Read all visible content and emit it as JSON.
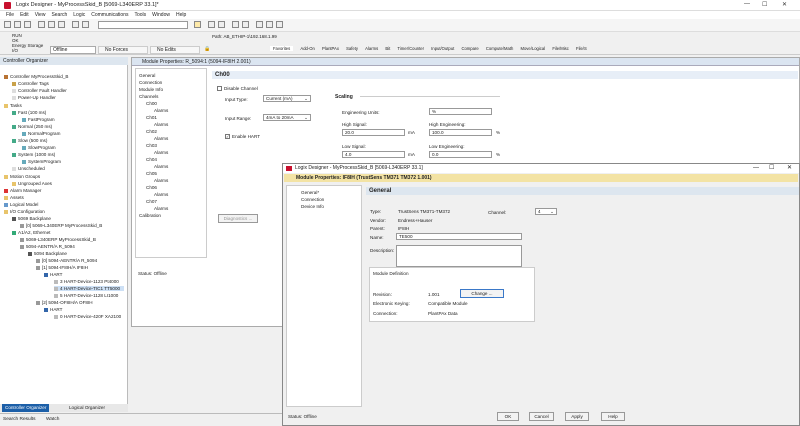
{
  "app": {
    "title": "Logix Designer - MyProcessSkid_B [5069-L340ERP 33.1]*",
    "menu": [
      "File",
      "Edit",
      "View",
      "Search",
      "Logic",
      "Communications",
      "Tools",
      "Window",
      "Help"
    ]
  },
  "status": {
    "run": "RUN",
    "ok": "OK",
    "energy": "Energy Storage",
    "io": "I/O",
    "offline": "Offline",
    "forces": "No Forces",
    "edits": "No Edits",
    "path": "Path: AB_ETHIP-1\\192.168.1.99"
  },
  "toolbar_tabs": [
    "Favorites",
    "Add-On",
    "PlantPAx",
    "Safety",
    "Alarms",
    "Bit",
    "Timer/Counter",
    "Input/Output",
    "Compare",
    "Compute/Math",
    "Move/Logical",
    "File/Misc",
    "File/S"
  ],
  "organizer": {
    "title": "Controller Organizer",
    "items": [
      "Controller MyProcessSkid_B",
      "Controller Tags",
      "Controller Fault Handler",
      "Power-Up Handler",
      "Tasks",
      "Fast (100 ms)",
      "FastProgram",
      "Normal (250 ms)",
      "NormalProgram",
      "Slow (500 ms)",
      "SlowProgram",
      "System (1000 ms)",
      "SystemProgram",
      "Unscheduled",
      "Motion Groups",
      "Ungrouped Axes",
      "Alarm Manager",
      "Assets",
      "Logical Model",
      "I/O Configuration",
      "5069 Backplane",
      "[0] 5069-L340ERP MyProcessSkid_B",
      "A1/A2, Ethernet",
      "5069-L340ERP MyProcessSkid_B",
      "5094-AENTR/A R_5094",
      "5094 Backplane",
      "[0] 5094-AENTR/A R_5094",
      "[1] 5094-IF8IH/A IF8IH",
      "HART",
      "3 HART-Device-1123 Pt4000",
      "4 HART-Device-TIC1 TT5000",
      "5 HART-Device-1128 LI1000",
      "[2] 5094-OF8IH/A OF8IH",
      "HART",
      "0 HART-Device-420F XA2100"
    ],
    "tabs": [
      "Controller Organizer",
      "Logical Organizer"
    ]
  },
  "bottom_tabs": [
    "Search Results",
    "Watch"
  ],
  "win1": {
    "title": "Module Properties: R_5094:1 (5094-IF8IH 2.001)",
    "nav": [
      "General",
      "Connection",
      "Module Info",
      "Channels",
      "Ch00",
      "Alarms",
      "Ch01",
      "Alarms",
      "Ch02",
      "Alarms",
      "Ch03",
      "Alarms",
      "Ch04",
      "Alarms",
      "Ch05",
      "Alarms",
      "Ch06",
      "Alarms",
      "Ch07",
      "Alarms",
      "Calibration"
    ],
    "section": "Ch00",
    "disable_channel": "Disable Channel",
    "input_type_label": "Input Type:",
    "input_type_value": "Current (mA)",
    "input_range_label": "Input Range:",
    "input_range_value": "4mA to 20mA",
    "enable_hart": "Enable HART",
    "scaling": "Scaling",
    "eng_units_label": "Engineering Units:",
    "eng_units_value": "%",
    "high_signal_label": "High Signal:",
    "high_signal_value": "20.0",
    "ma": "mA",
    "high_eng_label": "High Engineering:",
    "high_eng_value": "100.0",
    "pct": "%",
    "low_signal_label": "Low Signal:",
    "low_signal_value": "4.0",
    "low_eng_label": "Low Engineering:",
    "low_eng_value": "0.0",
    "diagnostics": "Diagnostics ...",
    "status": "Status:  Offline"
  },
  "win2": {
    "window_title": "Logix Designer - MyProcessSkid_B [5069-L340ERP 33.1]",
    "title": "Module Properties: IF8IH (TrustSens TM371 TM372 1.001)",
    "nav": [
      "General*",
      "Connection",
      "Device Info"
    ],
    "section": "General",
    "type_label": "Type:",
    "type_value": "TrustSens TM371-TM372",
    "vendor_label": "Vendor:",
    "vendor_value": "Endress+Hauser",
    "parent_label": "Parent:",
    "parent_value": "IF8IH",
    "name_label": "Name:",
    "name_value": "TE500",
    "desc_label": "Description:",
    "channel_label": "Channel:",
    "channel_value": "4",
    "module_def": "Module Definition",
    "revision_label": "Revision:",
    "revision_value": "1.001",
    "change": "Change ...",
    "keying_label": "Electronic Keying:",
    "keying_value": "Compatible Module",
    "connection_label": "Connection:",
    "connection_value": "PlantPAx Data",
    "status": "Status:  Offline",
    "buttons": [
      "OK",
      "Cancel",
      "Apply",
      "Help"
    ]
  }
}
